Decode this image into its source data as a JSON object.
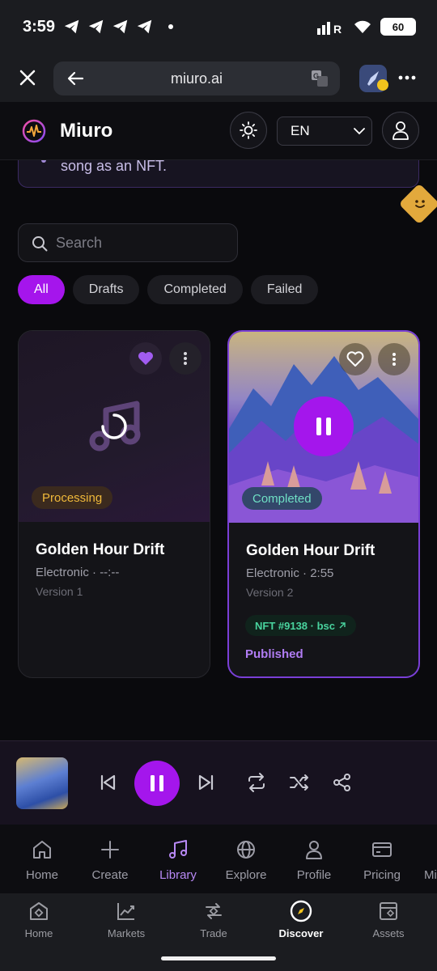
{
  "status_bar": {
    "time": "3:59",
    "battery": "60"
  },
  "browser": {
    "url": "miuro.ai"
  },
  "app_header": {
    "brand": "Miuro",
    "language": "EN"
  },
  "notice": {
    "text": "song as an NFT."
  },
  "search": {
    "placeholder": "Search"
  },
  "filters": [
    "All",
    "Drafts",
    "Completed",
    "Failed"
  ],
  "active_filter": "All",
  "tracks": [
    {
      "title": "Golden Hour Drift",
      "meta": "Electronic · --:--",
      "version": "Version 1",
      "status": "Processing",
      "favorited": true
    },
    {
      "title": "Golden Hour Drift",
      "meta": "Electronic · 2:55",
      "version": "Version 2",
      "status": "Completed",
      "nft": "NFT #9138 · bsc",
      "published": "Published",
      "favorited": false,
      "playing": true
    }
  ],
  "app_nav": [
    "Home",
    "Create",
    "Library",
    "Explore",
    "Profile",
    "Pricing",
    "Mi"
  ],
  "app_nav_active": "Library",
  "os_nav": [
    "Home",
    "Markets",
    "Trade",
    "Discover",
    "Assets"
  ],
  "os_nav_active": "Discover",
  "colors": {
    "accent": "#a515ec",
    "processing": "#f0b93a",
    "completed": "#6fe0c5",
    "nft": "#49d39e",
    "published": "#b07cf3"
  }
}
